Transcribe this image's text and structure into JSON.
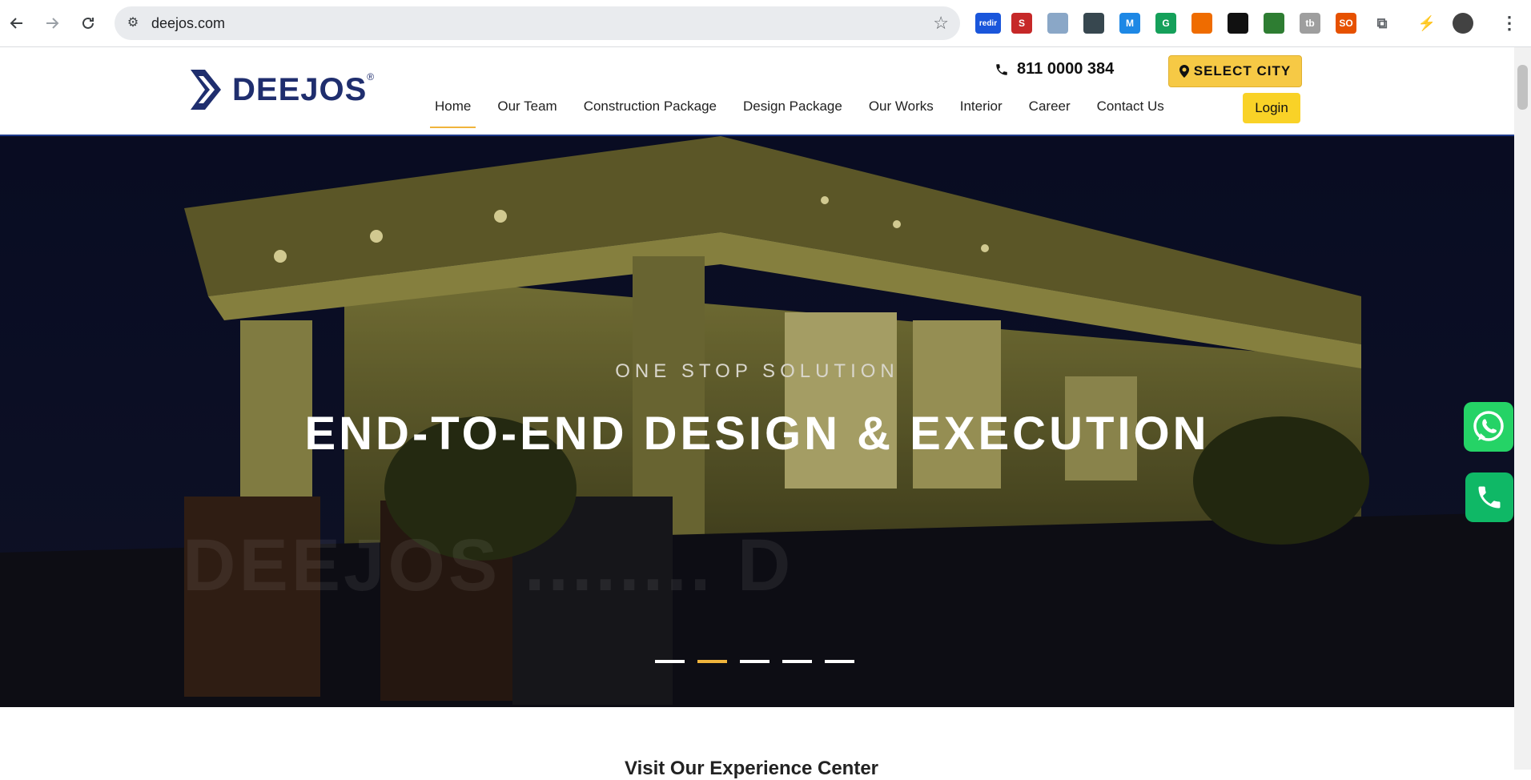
{
  "browser": {
    "url": "deejos.com",
    "extensions": [
      {
        "name": "redir-extension-icon",
        "label": "redir",
        "color": "#1a56db"
      },
      {
        "name": "s-extension-icon",
        "label": "S",
        "color": "#c62828"
      },
      {
        "name": "image-extension-icon",
        "label": "",
        "color": "#8aa7c7"
      },
      {
        "name": "folder-extension-icon",
        "label": "",
        "color": "#37474f"
      },
      {
        "name": "m-extension-icon",
        "label": "M",
        "color": "#1e88e5"
      },
      {
        "name": "grammarly-icon",
        "label": "G",
        "color": "#15a05a"
      },
      {
        "name": "chess-extension-icon",
        "label": "",
        "color": "#ef6c00"
      },
      {
        "name": "eye-extension-icon",
        "label": "",
        "color": "#111111"
      },
      {
        "name": "leaf-extension-icon",
        "label": "",
        "color": "#2e7d32"
      },
      {
        "name": "tb-extension-icon",
        "label": "tb",
        "color": "#9e9e9e"
      },
      {
        "name": "seo-extension-icon",
        "label": "SO",
        "color": "#e65100"
      },
      {
        "name": "puzzle-icon",
        "label": "",
        "color": "#5f6368"
      },
      {
        "name": "bolt-icon",
        "label": "",
        "color": "#5f6368"
      },
      {
        "name": "profile-avatar",
        "label": "",
        "color": "#424242"
      }
    ]
  },
  "header": {
    "logo_text": "DEEJOS",
    "logo_reg": "®",
    "phone": "811 0000 384",
    "select_city": "SELECT CITY",
    "login": "Login",
    "menu": [
      {
        "label": "Home",
        "active": true
      },
      {
        "label": "Our Team"
      },
      {
        "label": "Construction Package"
      },
      {
        "label": "Design Package"
      },
      {
        "label": "Our Works"
      },
      {
        "label": "Interior"
      },
      {
        "label": "Career"
      },
      {
        "label": "Contact Us"
      }
    ]
  },
  "hero": {
    "subtitle": "ONE STOP SOLUTION",
    "title": "END-TO-END DESIGN & EXECUTION",
    "ghost_text": "DEEJOS ........ D",
    "slides": 5,
    "active_slide": 2
  },
  "below": {
    "heading": "Visit Our Experience Center"
  },
  "colors": {
    "brand_navy": "#1f2e6e",
    "accent_yellow": "#f6c945",
    "whatsapp_green": "#25d366"
  }
}
